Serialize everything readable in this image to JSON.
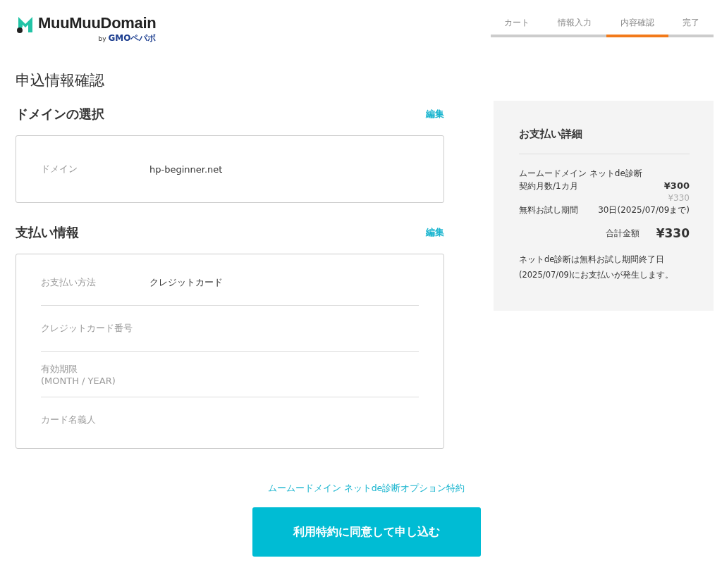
{
  "logo": {
    "name": "MuuMuuDomain",
    "by": "by",
    "company": "GMOペパボ"
  },
  "steps": [
    {
      "label": "カート",
      "selected": false
    },
    {
      "label": "情報入力",
      "selected": false
    },
    {
      "label": "内容確認",
      "selected": true
    },
    {
      "label": "完了",
      "selected": false
    }
  ],
  "page_title": "申込情報確認",
  "sections": [
    {
      "title": "ドメインの選択",
      "edit": "編集",
      "rows": [
        {
          "label": "ドメイン",
          "value": "hp-beginner.net"
        }
      ]
    },
    {
      "title": "支払い情報",
      "edit": "編集",
      "rows": [
        {
          "label": "お支払い方法",
          "value": "クレジットカード"
        },
        {
          "label": "クレジットカード番号"
        },
        {
          "label": "有効期限",
          "sublabel": "(MONTH / YEAR)"
        },
        {
          "label": "カード名義人"
        }
      ]
    }
  ],
  "summary": {
    "title": "お支払い詳細",
    "product": "ムームードメイン ネットde診断",
    "plan": "契約月数/1カ月",
    "price": "¥300",
    "price_tax": "¥330",
    "trial_label": "無料お試し期間",
    "trial_value": "30日(2025/07/09まで)",
    "total_label": "合計金額",
    "total": "¥330",
    "note": "ネットde診断は無料お試し期間終了日(2025/07/09)にお支払いが発生します。"
  },
  "terms_link": "ムームードメイン ネットde診断オプション特約",
  "submit": "利用特約に同意して申し込む"
}
